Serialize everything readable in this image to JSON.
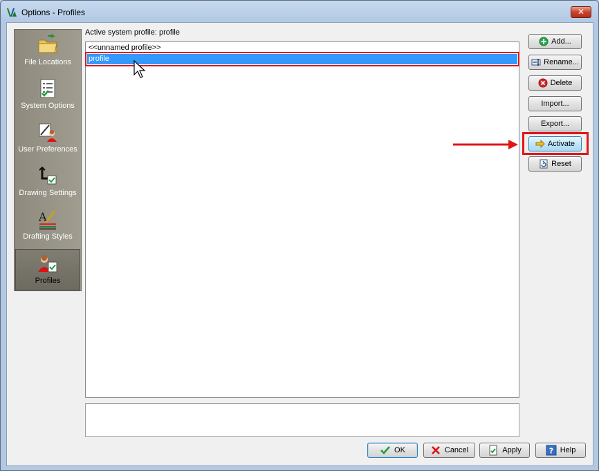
{
  "window": {
    "title": "Options - Profiles",
    "close_label": "✕"
  },
  "sidebar": {
    "items": [
      {
        "label": "File Locations",
        "icon": "folder-icon",
        "active": false
      },
      {
        "label": "System Options",
        "icon": "checklist-icon",
        "active": false
      },
      {
        "label": "User Preferences",
        "icon": "user-prefs-icon",
        "active": false
      },
      {
        "label": "Drawing Settings",
        "icon": "drawing-settings-icon",
        "active": false
      },
      {
        "label": "Drafting Styles",
        "icon": "drafting-styles-icon",
        "active": false
      },
      {
        "label": "Profiles",
        "icon": "profiles-icon",
        "active": true
      }
    ]
  },
  "main": {
    "active_profile_label": "Active system profile:  profile",
    "profiles": [
      {
        "name": "<<unnamed profile>>",
        "selected": false
      },
      {
        "name": "profile",
        "selected": true
      }
    ]
  },
  "actions": {
    "add": "Add...",
    "rename": "Rename...",
    "delete": "Delete",
    "import": "Import...",
    "export": "Export...",
    "activate": "Activate",
    "reset": "Reset"
  },
  "footer": {
    "ok": "OK",
    "cancel": "Cancel",
    "apply": "Apply",
    "help": "Help"
  },
  "colors": {
    "selection": "#3399ff",
    "highlight_frame": "#e0151a"
  }
}
